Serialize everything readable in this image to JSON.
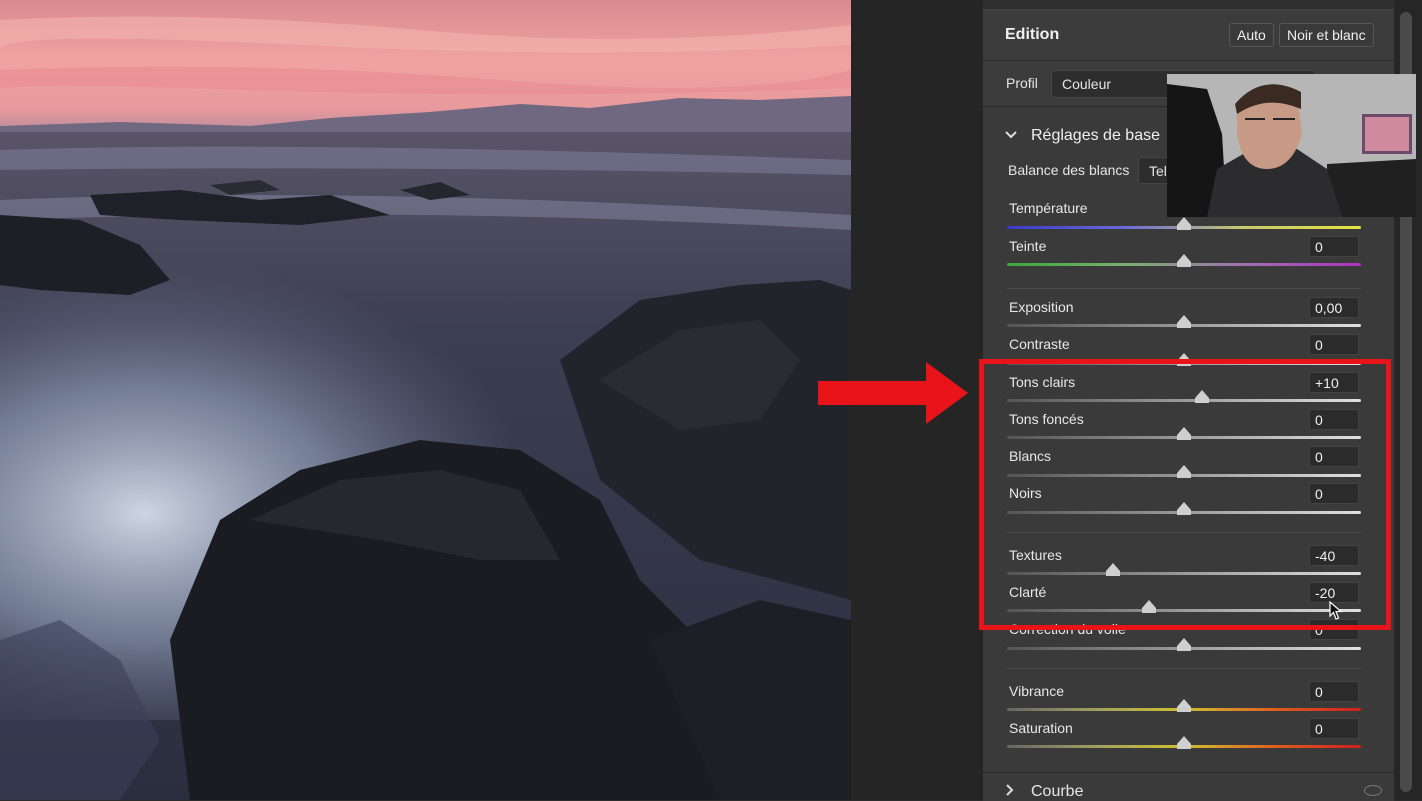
{
  "panel": {
    "title": "Edition",
    "auto_button": "Auto",
    "bw_button": "Noir et blanc",
    "profile_label": "Profil",
    "profile_value": "Couleur",
    "basic_section": "Réglages de base",
    "wb_label": "Balance des blancs",
    "wb_value": "Tel",
    "courbe_section": "Courbe"
  },
  "sliders": {
    "temperature": {
      "label": "Température",
      "value": "",
      "level": 0.5
    },
    "teinte": {
      "label": "Teinte",
      "value": "0",
      "level": 0.5
    },
    "exposition": {
      "label": "Exposition",
      "value": "0,00",
      "level": 0.5
    },
    "contraste": {
      "label": "Contraste",
      "value": "0",
      "level": 0.5
    },
    "tons_clairs": {
      "label": "Tons clairs",
      "value": "+10",
      "level": 0.55
    },
    "tons_fonces": {
      "label": "Tons foncés",
      "value": "0",
      "level": 0.5
    },
    "blancs": {
      "label": "Blancs",
      "value": "0",
      "level": 0.5
    },
    "noirs": {
      "label": "Noirs",
      "value": "0",
      "level": 0.5
    },
    "textures": {
      "label": "Textures",
      "value": "-40",
      "level": 0.3
    },
    "clarte": {
      "label": "Clarté",
      "value": "-20",
      "level": 0.4
    },
    "voile": {
      "label": "Correction du voile",
      "value": "0",
      "level": 0.5
    },
    "vibrance": {
      "label": "Vibrance",
      "value": "0",
      "level": 0.5
    },
    "saturation": {
      "label": "Saturation",
      "value": "0",
      "level": 0.5
    }
  },
  "colors": {
    "annotation_red": "#e8141a",
    "panel_bg": "#3a3a3a"
  }
}
